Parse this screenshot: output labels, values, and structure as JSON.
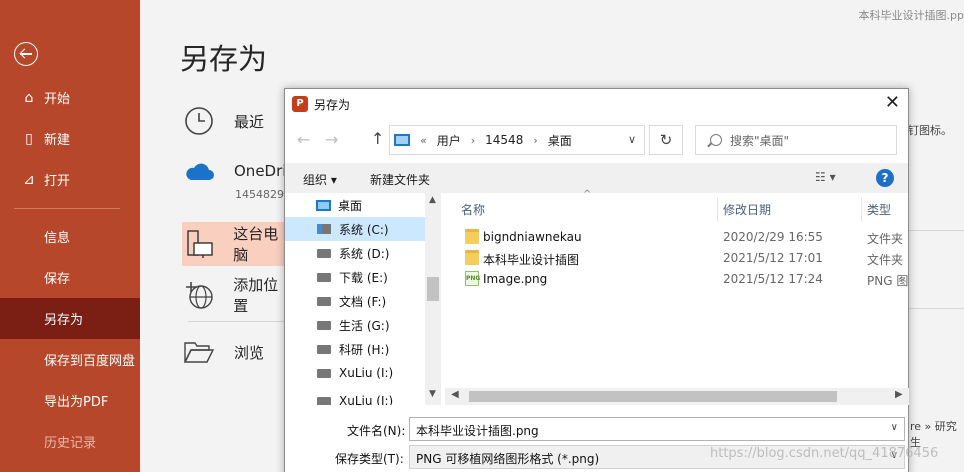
{
  "document_name": "本科毕业设计插图.pp",
  "sidebar": {
    "items": [
      {
        "label": "开始",
        "icon": "home-icon"
      },
      {
        "label": "新建",
        "icon": "new-file-icon"
      },
      {
        "label": "打开",
        "icon": "open-folder-icon"
      },
      {
        "label": "信息"
      },
      {
        "label": "保存"
      },
      {
        "label": "另存为"
      },
      {
        "label": "保存到百度网盘"
      },
      {
        "label": "导出为PDF"
      },
      {
        "label": "历史记录"
      }
    ]
  },
  "backstage": {
    "title": "另存为",
    "locations": [
      {
        "label": "最近"
      },
      {
        "label": "OneDri",
        "sub": "1454829"
      },
      {
        "label": "这台电脑"
      },
      {
        "label": "添加位置"
      },
      {
        "label": "浏览"
      }
    ],
    "right_snippet_1": "钉图标。",
    "right_snippet_2": "re » 研究生"
  },
  "dialog": {
    "title": "另存为",
    "breadcrumb": [
      "用户",
      "14548",
      "桌面"
    ],
    "breadcrumb_prefix": "«",
    "search_placeholder": "搜索\"桌面\"",
    "toolbar": {
      "organize": "组织 ▾",
      "new_folder": "新建文件夹"
    },
    "tree": [
      {
        "label": "桌面",
        "kind": "desktop"
      },
      {
        "label": "系统 (C:)",
        "kind": "system",
        "selected": true
      },
      {
        "label": "系统 (D:)",
        "kind": "drive"
      },
      {
        "label": "下载 (E:)",
        "kind": "drive"
      },
      {
        "label": "文档 (F:)",
        "kind": "drive"
      },
      {
        "label": "生活 (G:)",
        "kind": "drive"
      },
      {
        "label": "科研 (H:)",
        "kind": "drive"
      },
      {
        "label": "XuLiu (I:)",
        "kind": "drive"
      },
      {
        "label": "XuLiu (I:)",
        "kind": "drive"
      }
    ],
    "columns": {
      "name": "名称",
      "date": "修改日期",
      "type": "类型"
    },
    "files": [
      {
        "name": "bigndniawnekau",
        "date": "2020/2/29 16:55",
        "type": "文件夹",
        "kind": "folder"
      },
      {
        "name": "本科毕业设计插图",
        "date": "2021/5/12 17:01",
        "type": "文件夹",
        "kind": "folder"
      },
      {
        "name": "Image.png",
        "date": "2021/5/12 17:24",
        "type": "PNG 图",
        "kind": "png"
      }
    ],
    "filename_label": "文件名(N):",
    "filename_value": "本科毕业设计插图.png",
    "filetype_label": "保存类型(T):",
    "filetype_value": "PNG 可移植网络图形格式 (*.png)"
  },
  "watermark": "https://blog.csdn.net/qq_41876456"
}
